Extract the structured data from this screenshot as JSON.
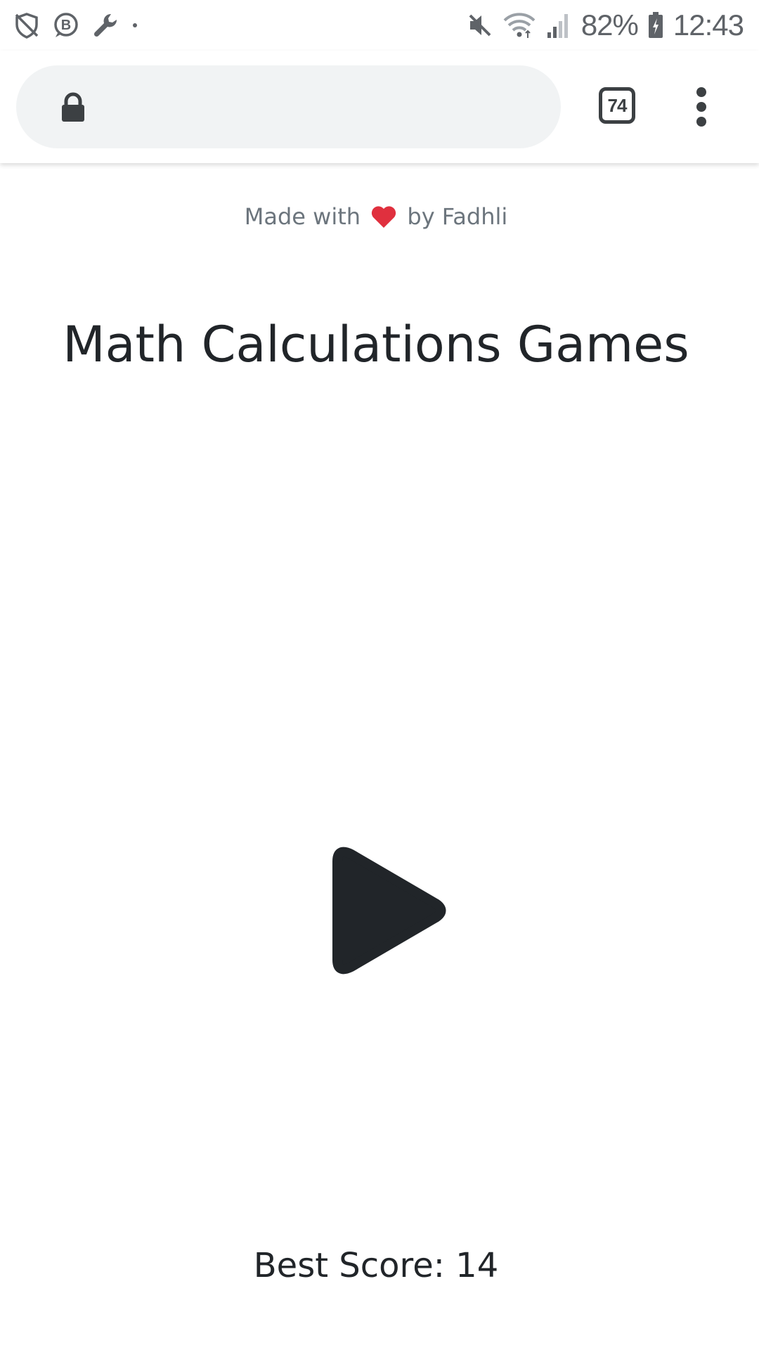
{
  "status_bar": {
    "left_icons": [
      "shield-off-icon",
      "b-badge-icon",
      "wrench-icon",
      "dot-icon"
    ],
    "right_icons": [
      "mute-icon",
      "wifi-icon",
      "signal-icon",
      "battery-icon"
    ],
    "battery": "82%",
    "time": "12:43"
  },
  "browser": {
    "url": "",
    "tab_count": "74",
    "icons": {
      "lock": "lock-icon",
      "menu": "more-vert-icon"
    }
  },
  "page": {
    "credit": {
      "prefix": "Made with",
      "heart_color": "#e0303e",
      "suffix": "by Fadhli"
    },
    "title": "Math Calculations Games",
    "play_icon": "play-icon",
    "best_score": {
      "label": "Best Score:",
      "value": "14"
    }
  },
  "colors": {
    "text_primary": "#212529",
    "text_muted": "#6c757d",
    "url_bar_bg": "#f1f3f4",
    "heart": "#e0303e"
  }
}
